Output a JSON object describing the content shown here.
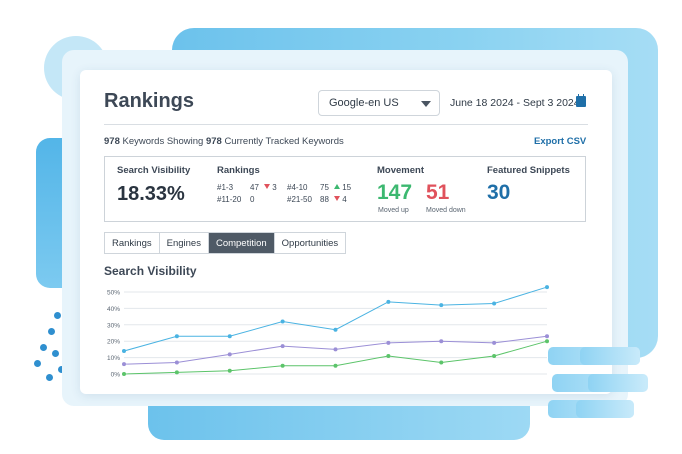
{
  "header": {
    "title": "Rankings",
    "engine_select": "Google-en US",
    "date_range": "June 18 2024 - Sept 3 2024"
  },
  "summary": {
    "keywords_showing": "978",
    "keywords_showing_text": "Keywords Showing",
    "tracked": "978",
    "tracked_text": "Currently Tracked Keywords",
    "export_label": "Export CSV"
  },
  "stats": {
    "search_visibility_label": "Search Visibility",
    "search_visibility_value": "18.33%",
    "rankings_label": "Rankings",
    "rankings": [
      {
        "range": "#1-3",
        "value": "47",
        "dir": "down",
        "change": "3"
      },
      {
        "range": "#4-10",
        "value": "75",
        "dir": "up",
        "change": "15"
      },
      {
        "range": "#11-20",
        "value": "0",
        "dir": "",
        "change": ""
      },
      {
        "range": "#21-50",
        "value": "88",
        "dir": "down",
        "change": "4"
      }
    ],
    "movement_label": "Movement",
    "moved_up_value": "147",
    "moved_up_label": "Moved up",
    "moved_down_value": "51",
    "moved_down_label": "Moved down",
    "featured_label": "Featured Snippets",
    "featured_value": "30"
  },
  "tabs": [
    {
      "label": "Rankings",
      "active": false
    },
    {
      "label": "Engines",
      "active": false
    },
    {
      "label": "Competition",
      "active": true
    },
    {
      "label": "Opportunities",
      "active": false
    }
  ],
  "section_title": "Search Visibility",
  "colors": {
    "accent": "#1f6fa8",
    "moved_up": "#3cb870",
    "moved_down": "#e0525c",
    "featured": "#1f6fa8"
  },
  "chart_data": {
    "type": "line",
    "title": "Search Visibility",
    "y_ticks": [
      "50%",
      "40%",
      "30%",
      "20%",
      "10%",
      "0%"
    ],
    "ylim": [
      0,
      50
    ],
    "grid": true,
    "series": [
      {
        "color": "#4ab3e2",
        "values": [
          14,
          23,
          23,
          32,
          27,
          44,
          42,
          43,
          53
        ]
      },
      {
        "color": "#9b8fd6",
        "values": [
          6,
          7,
          12,
          17,
          15,
          19,
          20,
          19,
          23
        ]
      },
      {
        "color": "#5cc46a",
        "values": [
          0,
          1,
          2,
          5,
          5,
          11,
          7,
          11,
          20
        ]
      }
    ]
  }
}
